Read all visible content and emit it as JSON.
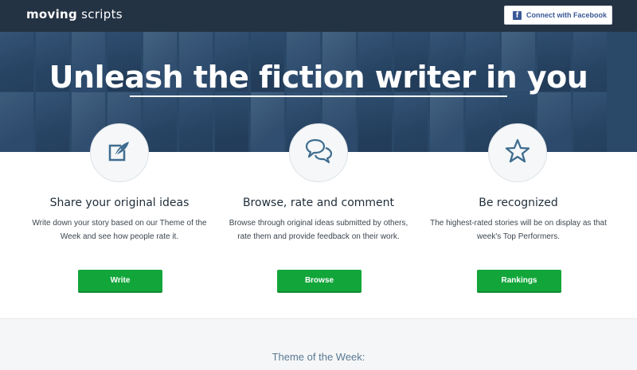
{
  "header": {
    "logo_part1": "moving",
    "logo_part2": "scripts",
    "connect_label": "Connect with Facebook",
    "fb_icon": "f"
  },
  "hero": {
    "title": "Unleash the fiction writer in you"
  },
  "features": [
    {
      "icon": "quill-icon",
      "title": "Share your original ideas",
      "text": "Write down your story based on our Theme of the Week and see how people rate it.",
      "button": "Write"
    },
    {
      "icon": "chat-bubbles-icon",
      "title": "Browse, rate and comment",
      "text": "Browse through original ideas submitted by others, rate them and provide feedback on their work.",
      "button": "Browse"
    },
    {
      "icon": "star-icon",
      "title": "Be recognized",
      "text": "The highest-rated stories will be on display as that week's Top Performers.",
      "button": "Rankings"
    }
  ],
  "theme": {
    "title": "Theme of the Week:"
  },
  "colors": {
    "topbar": "#243344",
    "accent_green": "#12a63a",
    "icon_blue": "#3f6d90",
    "facebook_blue": "#3b5998"
  }
}
